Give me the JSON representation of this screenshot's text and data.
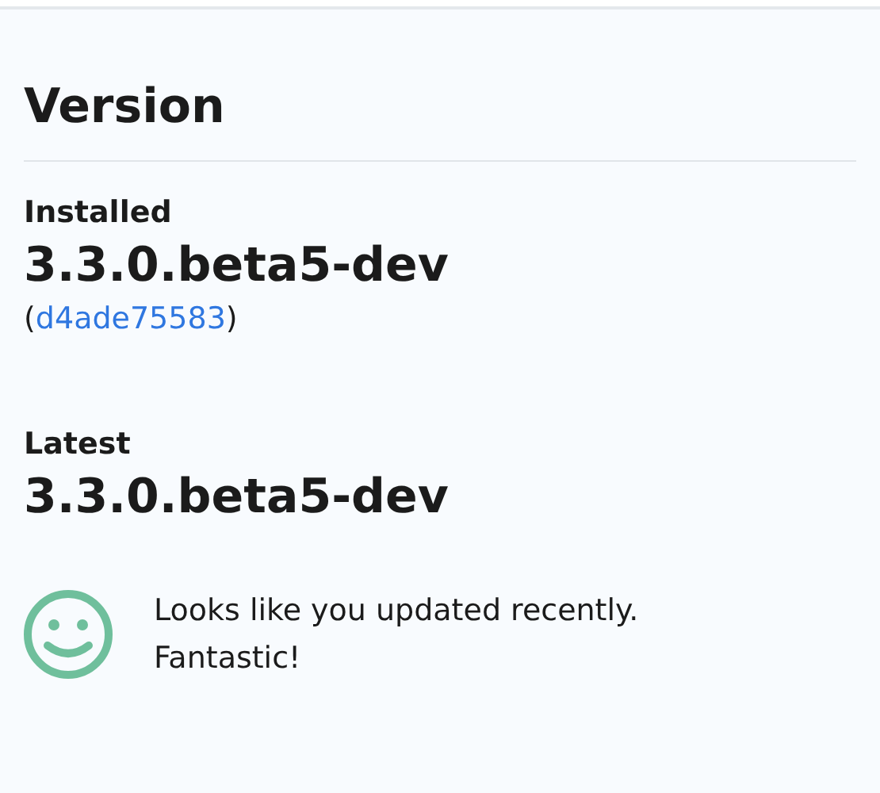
{
  "section": {
    "title": "Version"
  },
  "installed": {
    "label": "Installed",
    "version": "3.3.0.beta5-dev",
    "commit": {
      "open": "(",
      "hash": "d4ade75583",
      "close": ")"
    }
  },
  "latest": {
    "label": "Latest",
    "version": "3.3.0.beta5-dev"
  },
  "status": {
    "message": "Looks like you updated recently.",
    "exclamation": "Fantastic!"
  }
}
